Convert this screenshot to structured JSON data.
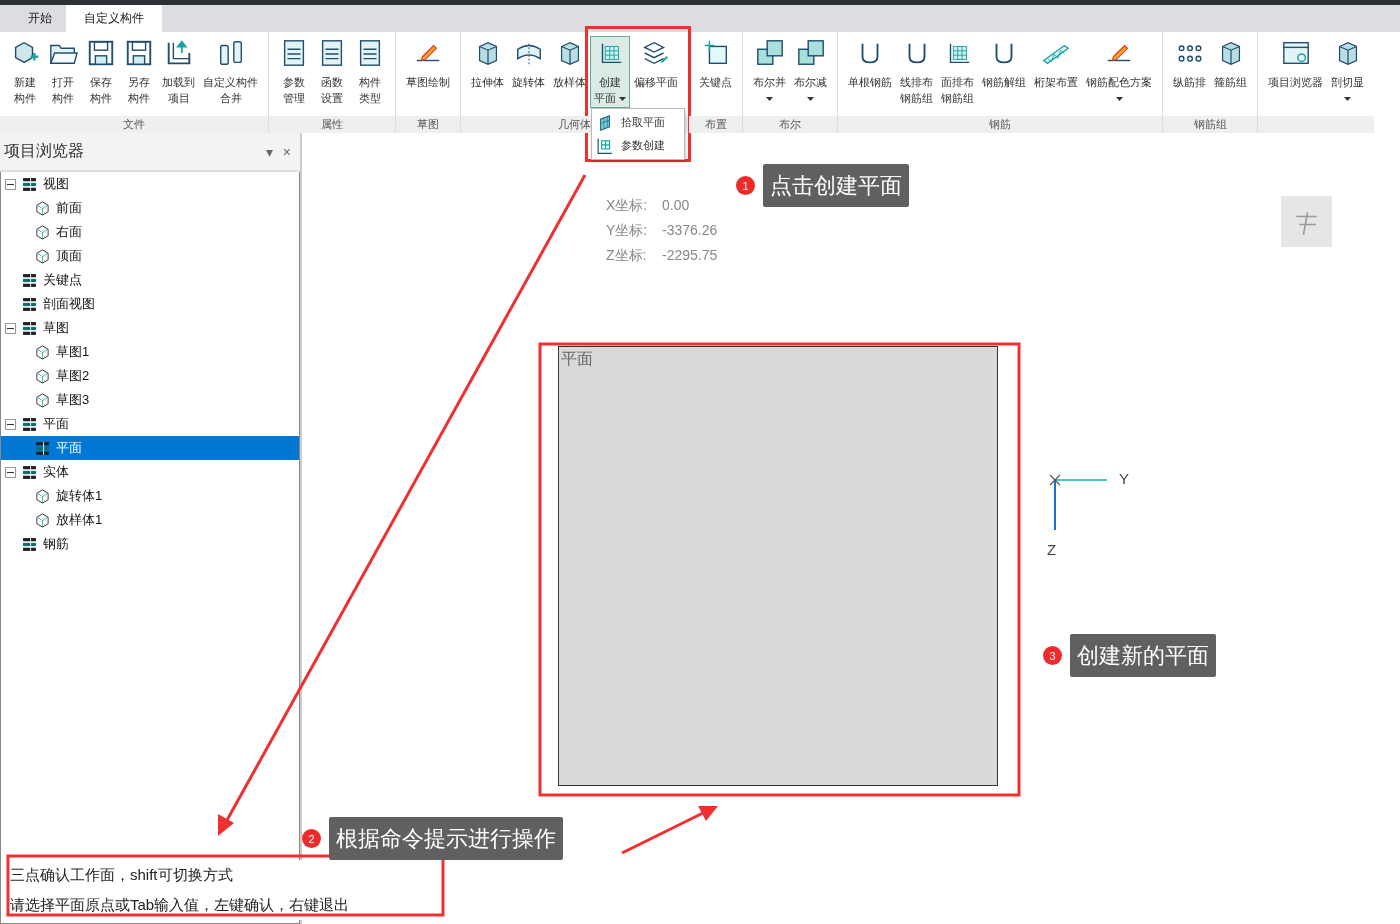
{
  "tabs": [
    {
      "label": "开始",
      "selected": false
    },
    {
      "label": "自定义构件",
      "selected": true
    }
  ],
  "ribbon": {
    "groups": [
      {
        "label": "文件",
        "buttons": [
          {
            "lines": [
              "新建",
              "构件"
            ]
          },
          {
            "lines": [
              "打开",
              "构件"
            ]
          },
          {
            "lines": [
              "保存",
              "构件"
            ]
          },
          {
            "lines": [
              "另存",
              "构件"
            ]
          },
          {
            "lines": [
              "加载到",
              "项目"
            ]
          },
          {
            "lines": [
              "自定义构件",
              "合并"
            ]
          }
        ]
      },
      {
        "label": "属性",
        "buttons": [
          {
            "lines": [
              "参数",
              "管理"
            ]
          },
          {
            "lines": [
              "函数",
              "设置"
            ]
          },
          {
            "lines": [
              "构件",
              "类型"
            ]
          }
        ]
      },
      {
        "label": "草图",
        "buttons": [
          {
            "lines": [
              "草图绘制"
            ]
          }
        ]
      },
      {
        "label": "几何体",
        "buttons": [
          {
            "lines": [
              "拉伸体"
            ]
          },
          {
            "lines": [
              "旋转体"
            ]
          },
          {
            "lines": [
              "放样体"
            ]
          },
          {
            "lines": [
              "创建",
              "平面"
            ],
            "dropdown": true,
            "selected": true
          },
          {
            "lines": [
              "偏移平面"
            ]
          }
        ]
      },
      {
        "label": "布置",
        "buttons": [
          {
            "lines": [
              "关键点"
            ]
          }
        ]
      },
      {
        "label": "布尔",
        "buttons": [
          {
            "lines": [
              "布尔并"
            ],
            "dropdown": true
          },
          {
            "lines": [
              "布尔减"
            ],
            "dropdown": true
          }
        ]
      },
      {
        "label": "钢筋",
        "buttons": [
          {
            "lines": [
              "单根钢筋"
            ]
          },
          {
            "lines": [
              "线排布",
              "钢筋组"
            ]
          },
          {
            "lines": [
              "面排布",
              "钢筋组"
            ]
          },
          {
            "lines": [
              "钢筋解组"
            ]
          },
          {
            "lines": [
              "桁架布置"
            ]
          },
          {
            "lines": [
              "钢筋配色方案"
            ],
            "dropdown": true
          }
        ]
      },
      {
        "label": "钢筋组",
        "buttons": [
          {
            "lines": [
              "纵筋排"
            ]
          },
          {
            "lines": [
              "箍筋组"
            ]
          }
        ]
      },
      {
        "buttons": [
          {
            "lines": [
              "项目浏览器"
            ]
          },
          {
            "lines": [
              "剖切显"
            ],
            "dropdown": true
          }
        ]
      }
    ]
  },
  "dropdown_menu": {
    "items": [
      {
        "label": "拾取平面"
      },
      {
        "label": "参数创建"
      }
    ]
  },
  "browser": {
    "title": "项目浏览器",
    "menu_glyph": "▾",
    "close_glyph": "×",
    "tree": [
      {
        "label": "视图",
        "kind": "stack",
        "selected": false,
        "expanded": true,
        "children": [
          {
            "label": "前面",
            "kind": "cube",
            "selected": false
          },
          {
            "label": "右面",
            "kind": "cube",
            "selected": false
          },
          {
            "label": "顶面",
            "kind": "cube",
            "selected": false
          }
        ]
      },
      {
        "label": "关键点",
        "kind": "stack",
        "selected": false
      },
      {
        "label": "剖面视图",
        "kind": "stack",
        "selected": false
      },
      {
        "label": "草图",
        "kind": "stack",
        "selected": false,
        "expanded": true,
        "children": [
          {
            "label": "草图1",
            "kind": "cube",
            "selected": false
          },
          {
            "label": "草图2",
            "kind": "cube",
            "selected": false
          },
          {
            "label": "草图3",
            "kind": "cube",
            "selected": false
          }
        ]
      },
      {
        "label": "平面",
        "kind": "stack",
        "selected": false,
        "expanded": true,
        "children": [
          {
            "label": "平面",
            "kind": "stack",
            "selected": true
          }
        ]
      },
      {
        "label": "实体",
        "kind": "stack",
        "selected": false,
        "expanded": true,
        "children": [
          {
            "label": "旋转体1",
            "kind": "cube",
            "selected": false
          },
          {
            "label": "放样体1",
            "kind": "cube",
            "selected": false
          }
        ]
      },
      {
        "label": "钢筋",
        "kind": "stack",
        "selected": false
      }
    ]
  },
  "canvas": {
    "coordinates": [
      {
        "label": "X坐标:",
        "value": "0.00"
      },
      {
        "label": "Y坐标:",
        "value": "-3376.26"
      },
      {
        "label": "Z坐标:",
        "value": "-2295.75"
      }
    ],
    "plane_label": "平面",
    "axes": {
      "y": "Y",
      "z": "Z"
    }
  },
  "prompt": {
    "lines": [
      "三点确认工作面，shift可切换方式",
      "请选择平面原点或Tab输入值，左键确认，右键退出"
    ]
  },
  "annotations": {
    "callouts": [
      {
        "number": "1",
        "text": "点击创建平面"
      },
      {
        "number": "2",
        "text": "根据命令提示进行操作"
      },
      {
        "number": "3",
        "text": "创建新的平面"
      }
    ]
  }
}
